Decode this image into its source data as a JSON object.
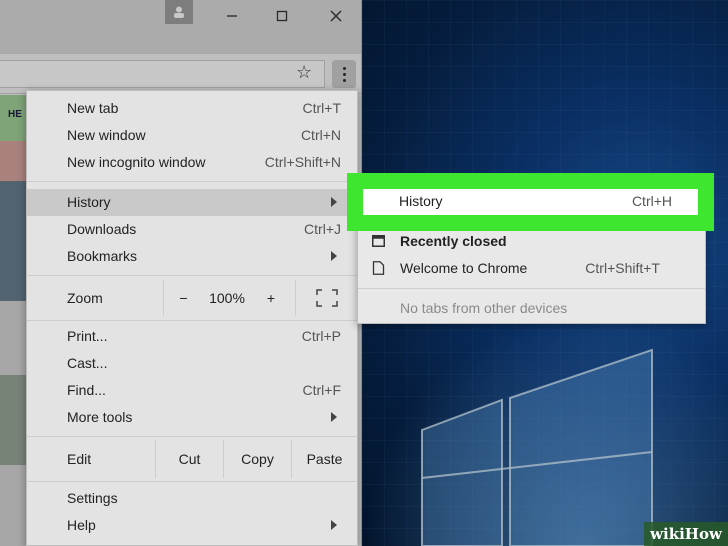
{
  "colors": {
    "highlight_green": "#3ee62f",
    "menu_bg": "#e3e3e3",
    "desktop_blue": "#0d3d80"
  },
  "titlebar": {
    "icons": [
      "person-icon",
      "minimize-icon",
      "maximize-icon",
      "close-icon"
    ]
  },
  "toolbar": {
    "star_icon": "star-icon",
    "menu_icon": "more-vertical-icon"
  },
  "page": {
    "partial_text": "HE"
  },
  "menu": {
    "new_tab": {
      "label": "New tab",
      "shortcut": "Ctrl+T"
    },
    "new_window": {
      "label": "New window",
      "shortcut": "Ctrl+N"
    },
    "new_incognito": {
      "label": "New incognito window",
      "shortcut": "Ctrl+Shift+N"
    },
    "history": {
      "label": "History"
    },
    "downloads": {
      "label": "Downloads",
      "shortcut": "Ctrl+J"
    },
    "bookmarks": {
      "label": "Bookmarks"
    },
    "zoom": {
      "label": "Zoom",
      "minus": "−",
      "level": "100%",
      "plus": "+"
    },
    "print": {
      "label": "Print...",
      "shortcut": "Ctrl+P"
    },
    "cast": {
      "label": "Cast..."
    },
    "find": {
      "label": "Find...",
      "shortcut": "Ctrl+F"
    },
    "more_tools": {
      "label": "More tools"
    },
    "edit": {
      "label": "Edit",
      "cut": "Cut",
      "copy": "Copy",
      "paste": "Paste"
    },
    "settings": {
      "label": "Settings"
    },
    "help": {
      "label": "Help"
    }
  },
  "history_submenu": {
    "history": {
      "label": "History",
      "shortcut": "Ctrl+H"
    },
    "recently_closed": "Recently closed",
    "welcome": {
      "label": "Welcome to Chrome",
      "shortcut": "Ctrl+Shift+T"
    },
    "no_tabs": "No tabs from other devices"
  },
  "watermark": "wikiHow"
}
